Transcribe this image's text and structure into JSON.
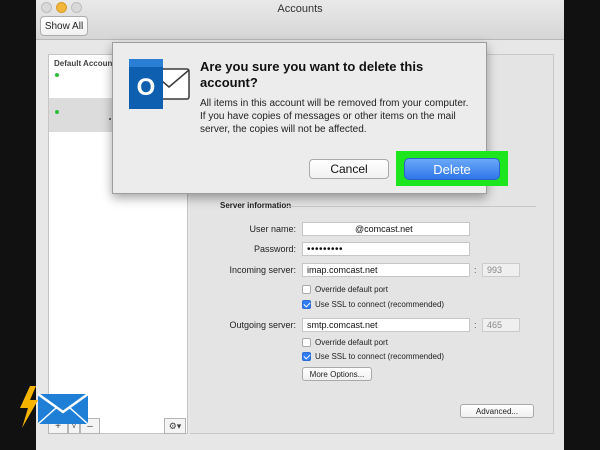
{
  "window": {
    "title": "Accounts",
    "show_all_label": "Show All"
  },
  "sidebar": {
    "section_label": "Default Account",
    "add_label": "+",
    "add_chevron": "v",
    "remove_label": "–",
    "gear_label": "⚙▾"
  },
  "dialog": {
    "title": "Are you sure you want to delete this account?",
    "body": "All items in this account will be removed from your computer. If you have copies of messages or other items on the mail server, the copies will not be affected.",
    "cancel_label": "Cancel",
    "delete_label": "Delete",
    "icon_letter": "O"
  },
  "server": {
    "section_title": "Server information",
    "username_label": "User name:",
    "username_value": "@comcast.net",
    "password_label": "Password:",
    "password_value": "•••••••••",
    "incoming_label": "Incoming server:",
    "incoming_value": "imap.comcast.net",
    "incoming_port": "993",
    "outgoing_label": "Outgoing server:",
    "outgoing_value": "smtp.comcast.net",
    "outgoing_port": "465",
    "colon": ":",
    "override_label": "Override default port",
    "ssl_label": "Use SSL to connect (recommended)",
    "more_options_label": "More Options...",
    "advanced_label": "Advanced..."
  },
  "colors": {
    "accent": "#2f76ea",
    "highlight": "#1ee61e",
    "outlook_blue": "#0f5fb0"
  }
}
